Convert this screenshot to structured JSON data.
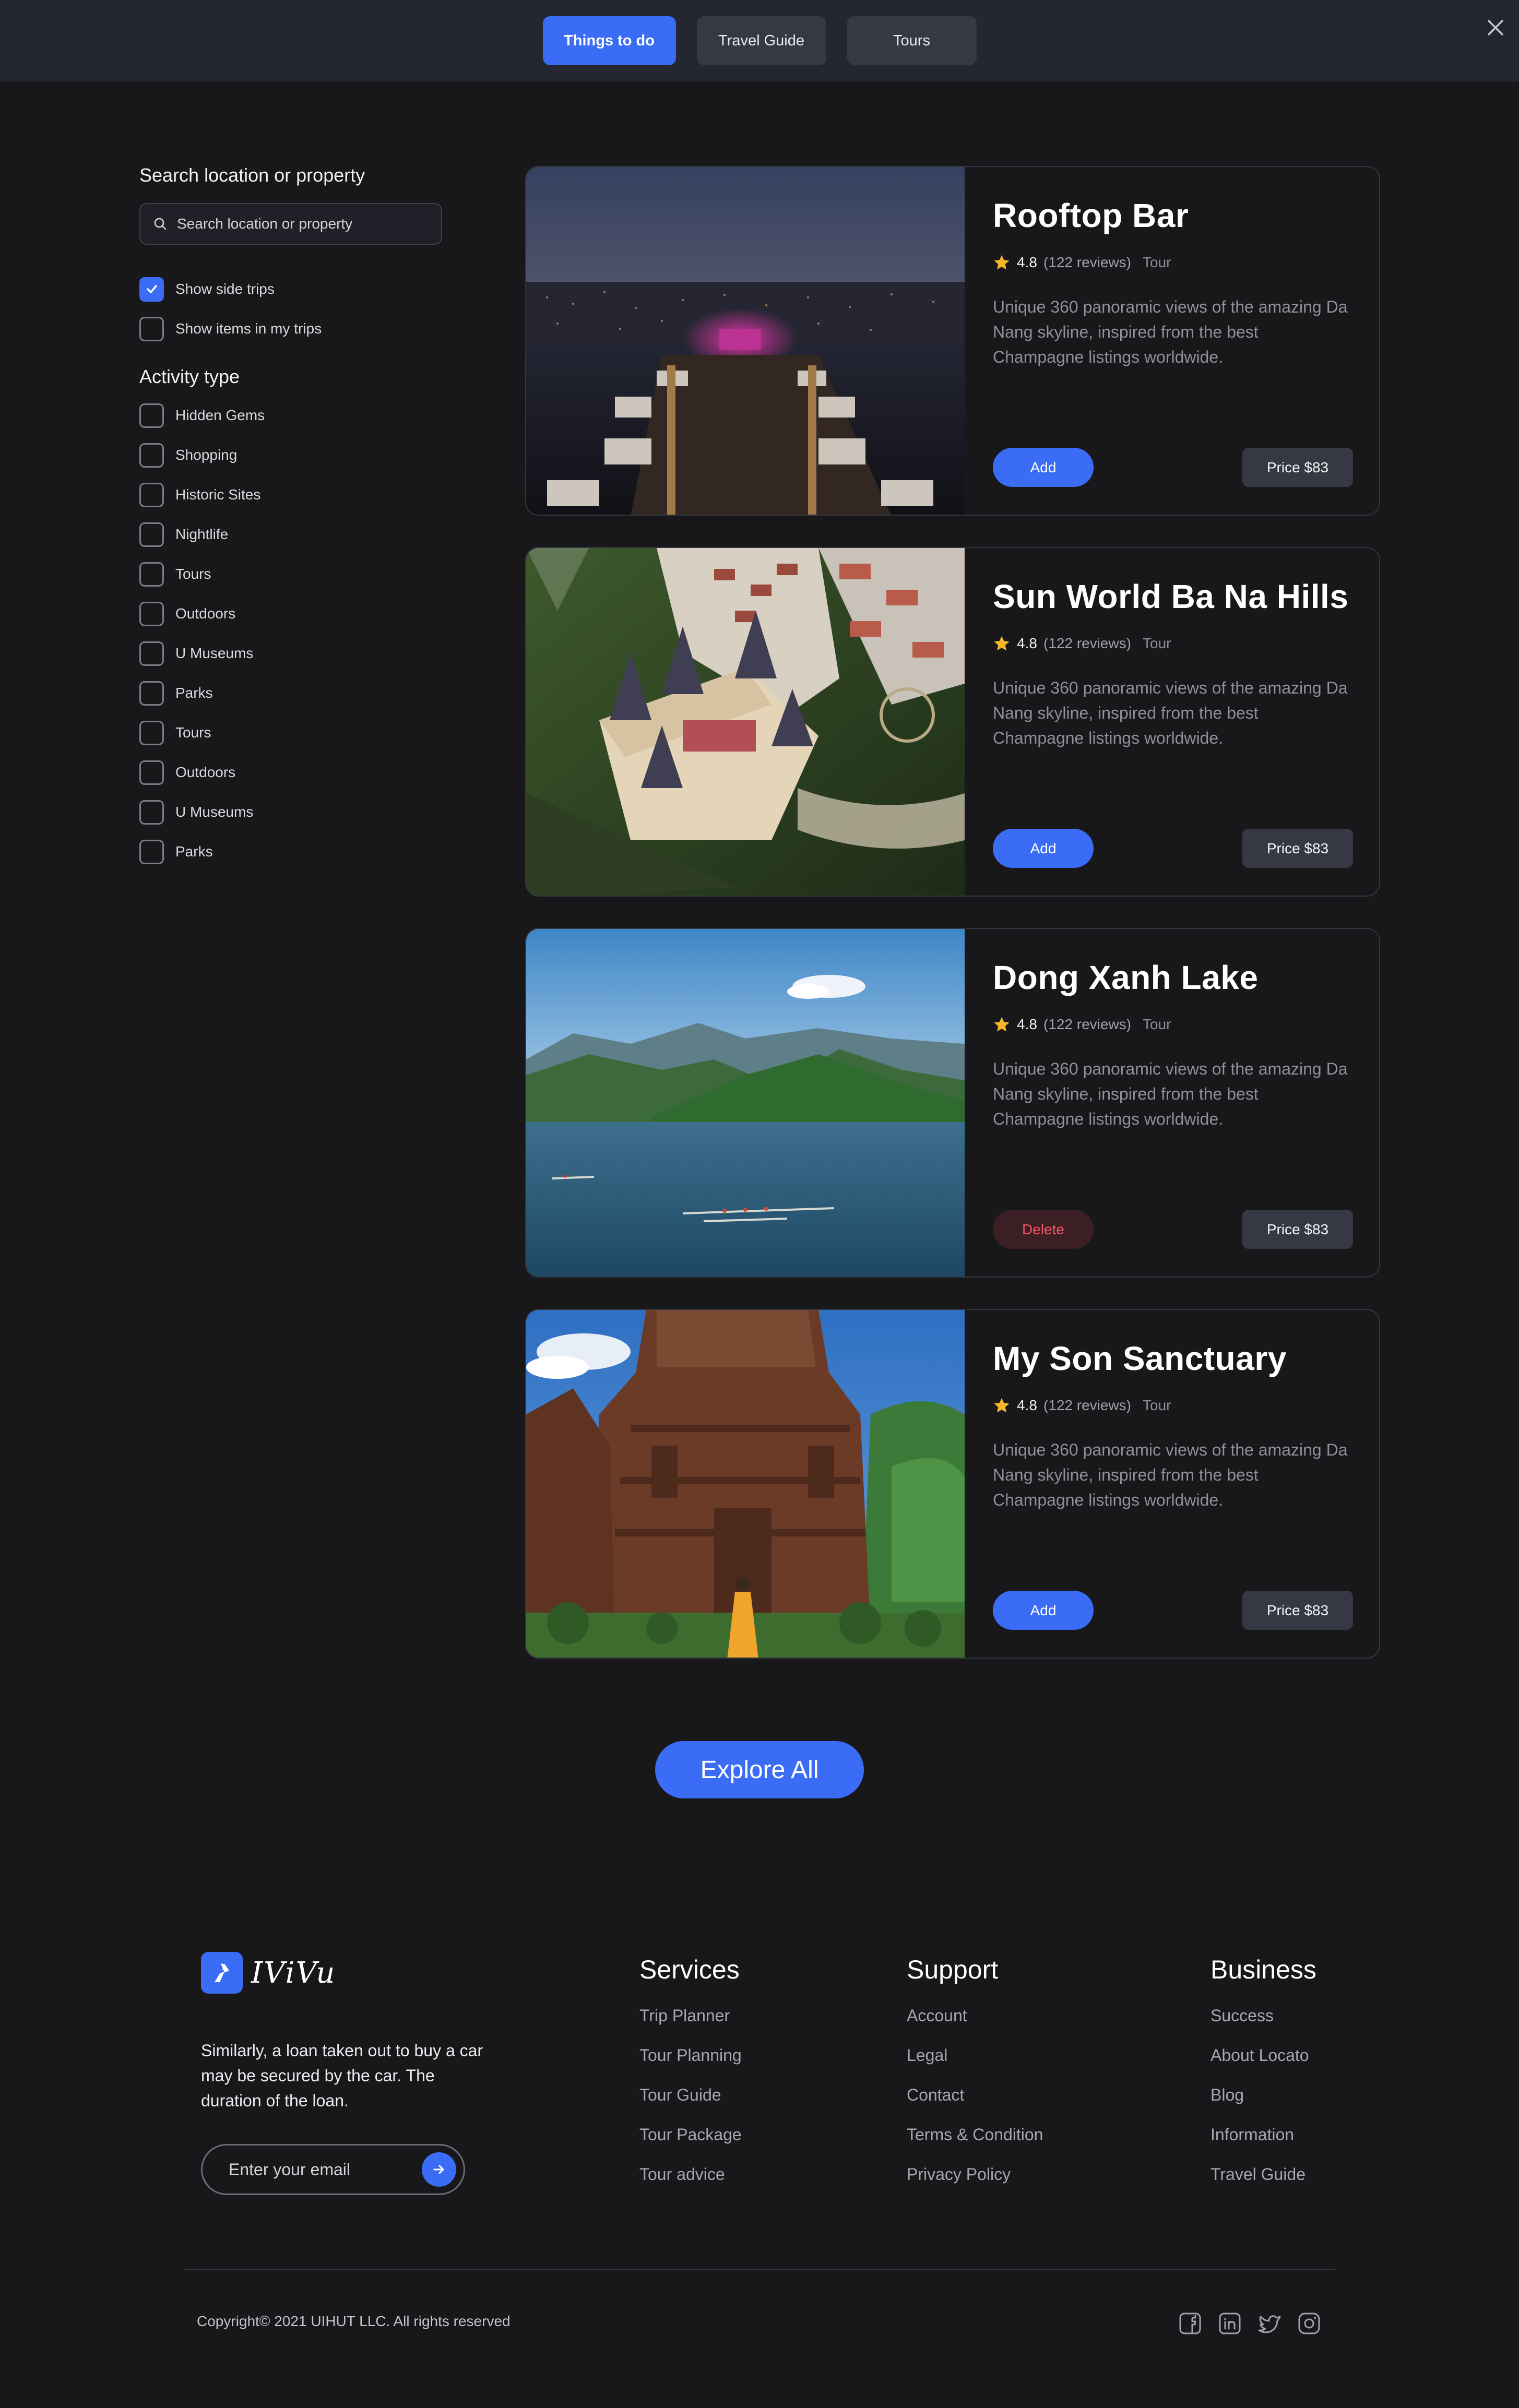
{
  "header": {
    "tabs": [
      {
        "label": "Things  to do",
        "active": true
      },
      {
        "label": "Travel Guide",
        "active": false
      },
      {
        "label": "Tours",
        "active": false
      }
    ],
    "close_icon": "close-icon"
  },
  "sidebar": {
    "search_title": "Search location or property",
    "search_placeholder": "Search location or property",
    "options": [
      {
        "label": "Show side trips",
        "checked": true
      },
      {
        "label": "Show items in my trips",
        "checked": false
      }
    ],
    "activity_title": "Activity type",
    "activities": [
      {
        "label": "Hidden Gems",
        "checked": false
      },
      {
        "label": "Shopping",
        "checked": false
      },
      {
        "label": "Historic Sites",
        "checked": false
      },
      {
        "label": "Nightlife",
        "checked": false
      },
      {
        "label": "Tours",
        "checked": false
      },
      {
        "label": "Outdoors",
        "checked": false
      },
      {
        "label": "U Museums",
        "checked": false
      },
      {
        "label": "Parks",
        "checked": false
      },
      {
        "label": "Tours",
        "checked": false
      },
      {
        "label": "Outdoors",
        "checked": false
      },
      {
        "label": "U Museums",
        "checked": false
      },
      {
        "label": "Parks",
        "checked": false
      }
    ]
  },
  "cards": [
    {
      "title": "Rooftop Bar",
      "rating": "4.8",
      "reviews": "(122 reviews)",
      "type": "Tour",
      "description": "Unique 360 panoramic views of the amazing Da Nang skyline, inspired from the best Champagne listings worldwide.",
      "action_label": "Add",
      "price_label": "Price $83"
    },
    {
      "title": "Sun World Ba Na Hills",
      "rating": "4.8",
      "reviews": "(122 reviews)",
      "type": "Tour",
      "description": "Unique 360 panoramic views of the amazing Da Nang skyline, inspired from the best Champagne listings worldwide.",
      "action_label": "Add",
      "price_label": "Price $83"
    },
    {
      "title": "Dong Xanh Lake",
      "rating": "4.8",
      "reviews": "(122 reviews)",
      "type": "Tour",
      "description": "Unique 360 panoramic views of the amazing Da Nang skyline, inspired from the best Champagne listings worldwide.",
      "action_label": "Delete",
      "price_label": "Price $83"
    },
    {
      "title": "My Son Sanctuary",
      "rating": "4.8",
      "reviews": "(122 reviews)",
      "type": "Tour",
      "description": "Unique 360 panoramic views of the amazing Da Nang skyline, inspired from the best Champagne listings worldwide.",
      "action_label": "Add",
      "price_label": "Price $83"
    }
  ],
  "explore_label": "Explore All",
  "footer": {
    "brand": "IViVu",
    "about": "Similarly, a loan taken out to buy a car may be secured by the car. The duration of the loan.",
    "email_placeholder": "Enter your email",
    "columns": [
      {
        "title": "Services",
        "links": [
          "Trip Planner",
          "Tour Planning",
          "Tour Guide",
          "Tour Package",
          "Tour advice"
        ]
      },
      {
        "title": "Support",
        "links": [
          "Account",
          "Legal",
          "Contact",
          "Terms & Condition",
          "Privacy Policy"
        ]
      },
      {
        "title": "Business",
        "links": [
          "Success",
          "About Locato",
          "Blog",
          "Information",
          "Travel Guide"
        ]
      }
    ],
    "copyright": "Copyright© 2021 UIHUT LLC. All rights reserved",
    "socials": [
      "facebook-icon",
      "linkedin-icon",
      "twitter-icon",
      "instagram-icon"
    ]
  },
  "colors": {
    "accent": "#3b6cf6",
    "background": "#18181b",
    "danger": "#f05563",
    "star": "#f5b62a"
  }
}
